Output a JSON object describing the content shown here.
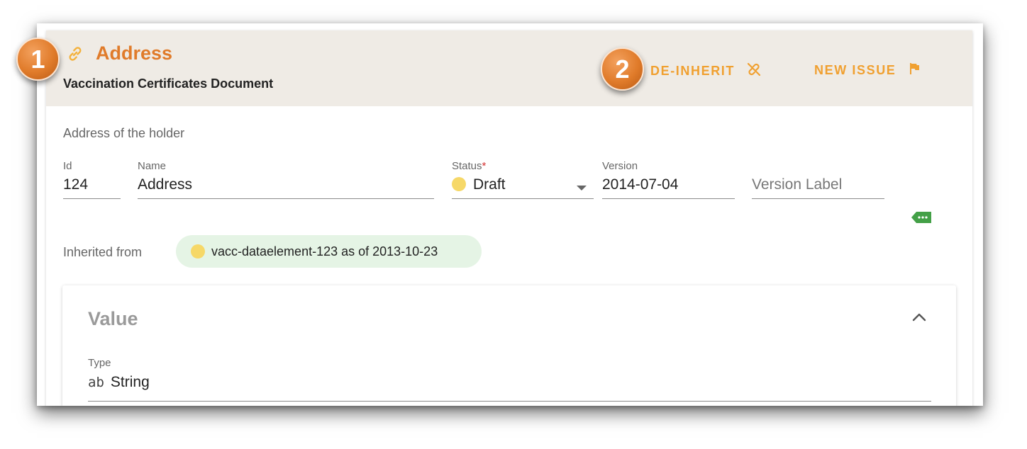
{
  "colors": {
    "accent_title": "#e07b2a",
    "accent_action": "#f0a030",
    "header_bg": "#efebe5",
    "status_dot": "#f6d868",
    "chip_bg": "#e5f4e5",
    "tag_green": "#43a047"
  },
  "annotations": [
    {
      "number": "1"
    },
    {
      "number": "2"
    }
  ],
  "header": {
    "icon": "link-icon",
    "title": "Address",
    "subtitle": "Vaccination Certificates Document",
    "actions": [
      {
        "label": "DE-INHERIT",
        "icon": "link-off-icon"
      },
      {
        "label": "NEW ISSUE",
        "icon": "flag-icon"
      }
    ]
  },
  "description": "Address of the holder",
  "fields": {
    "id": {
      "label": "Id",
      "value": "124"
    },
    "name": {
      "label": "Name",
      "value": "Address"
    },
    "status": {
      "label": "Status",
      "required_mark": "*",
      "value": "Draft"
    },
    "version": {
      "label": "Version",
      "value": "2014-07-04"
    },
    "version_label": {
      "placeholder": "Version Label"
    }
  },
  "tag_button": {
    "icon": "tag-more-icon"
  },
  "inherited": {
    "label": "Inherited from",
    "chip": "vacc-dataelement-123 as of 2013-10-23"
  },
  "value_panel": {
    "title": "Value",
    "collapse_icon": "chevron-up-icon",
    "type_label": "Type",
    "type_icon_text": "ab",
    "type_value": "String"
  }
}
